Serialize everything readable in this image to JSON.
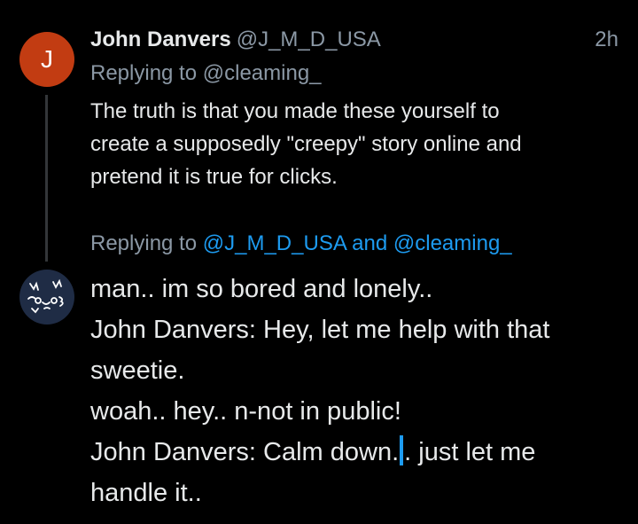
{
  "tweet1": {
    "avatar_letter": "J",
    "avatar_color": "#c23c12",
    "author_name": "John Danvers",
    "author_handle": "@J_M_D_USA",
    "time": "2h",
    "replying_prefix": "Replying to",
    "replying_handle": "@cleaming_",
    "text_lines": [
      "The truth is that you made these yourself to",
      "create a supposedly \"creepy\" story online and",
      "pretend it is true for clicks."
    ]
  },
  "tweet2": {
    "avatar_icon": "doodle-face-avatar",
    "replying_prefix": "Replying to",
    "replying_mentions": "@J_M_D_USA and @cleaming_",
    "text_lines": [
      "man.. im so bored and lonely..",
      "John Danvers: Hey, let me help with that",
      "sweetie.",
      "woah.. hey.. n-not in public!"
    ],
    "line5_before_cursor": "John Danvers: Calm down.",
    "line5_after_cursor": ". just let me",
    "line6": "handle it.."
  },
  "colors": {
    "background": "#000000",
    "text": "#e7e9ea",
    "secondary": "#8b98a5",
    "accent": "#1d9bf0"
  }
}
